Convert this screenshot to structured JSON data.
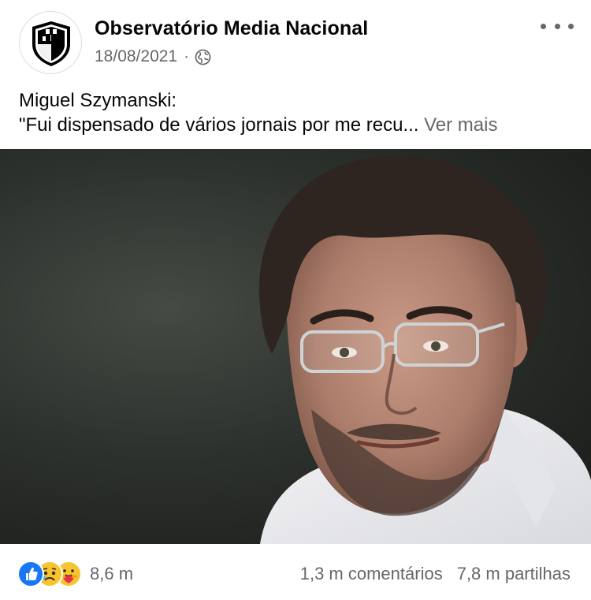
{
  "post": {
    "page_name": "Observatório Media Nacional",
    "date": "18/08/2021",
    "date_separator": "·",
    "audience_icon": "globe-icon",
    "text_line1": "Miguel Szymanski:",
    "text_line2": "\"Fui dispensado de vários jornais por me recu...",
    "see_more": "Ver mais"
  },
  "engagement": {
    "reaction_icons": [
      "like-icon",
      "sad-icon",
      "care-icon"
    ],
    "reaction_count": "8,6 m",
    "comments": "1,3 m comentários",
    "shares": "7,8 m partilhas"
  },
  "colors": {
    "secondary_text": "#65676b",
    "like_blue": "#1877f2",
    "emoji_yellow": "#f7c531"
  }
}
